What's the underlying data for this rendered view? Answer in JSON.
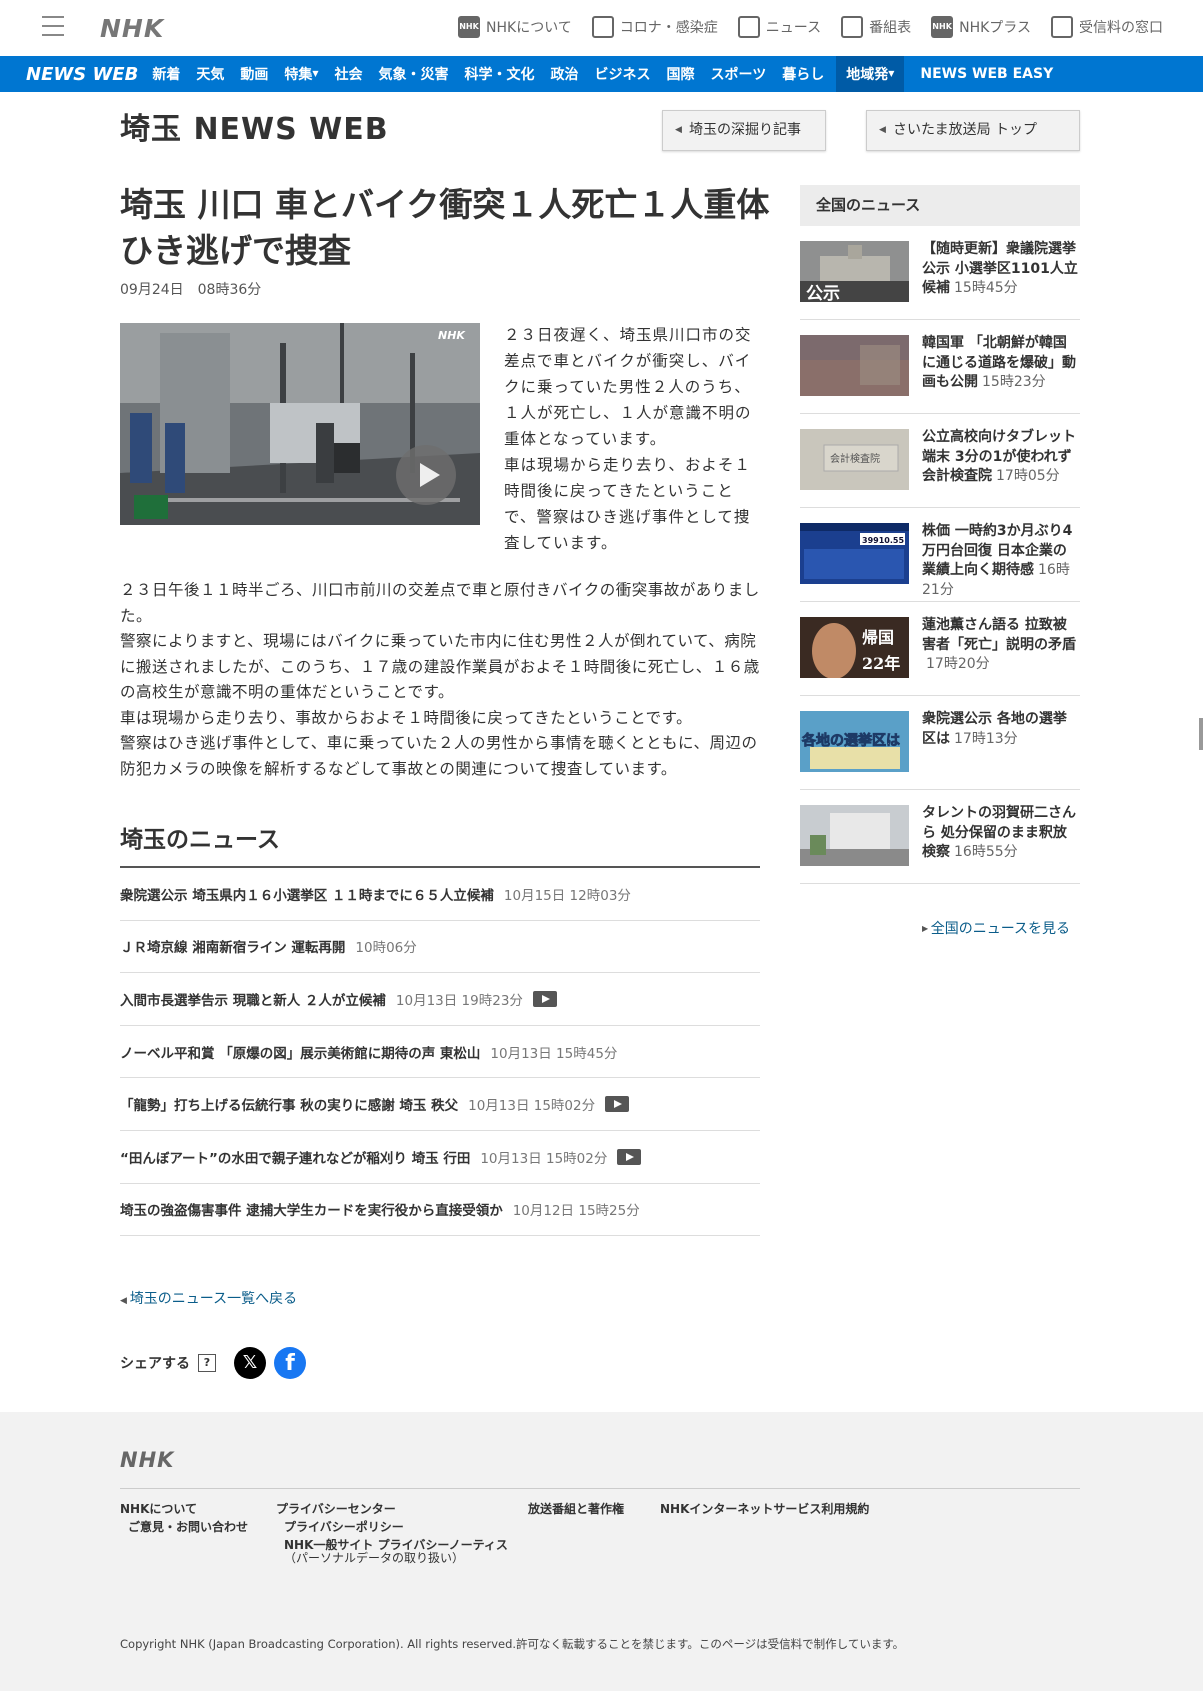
{
  "top": {
    "logo": "NHK",
    "links": [
      {
        "label": "NHKについて",
        "icon": "nhk-icon"
      },
      {
        "label": "コロナ・感染症",
        "icon": "document-icon"
      },
      {
        "label": "ニュース",
        "icon": "news-icon"
      },
      {
        "label": "番組表",
        "icon": "grid-icon"
      },
      {
        "label": "NHKプラス",
        "icon": "nhk-plus-icon"
      },
      {
        "label": "受信料の窓口",
        "icon": "tv-icon"
      }
    ]
  },
  "nav": {
    "brand": "NEWS WEB",
    "items": [
      "新着",
      "天気",
      "動画",
      "特集",
      "社会",
      "気象・災害",
      "科学・文化",
      "政治",
      "ビジネス",
      "国際",
      "スポーツ",
      "暮らし",
      "地域発",
      "NEWS WEB EASY"
    ]
  },
  "header": {
    "title": "埼玉 NEWS WEB",
    "btn_deep": "埼玉の深掘り記事",
    "btn_top": "さいたま放送局 トップ"
  },
  "article": {
    "title": "埼玉 川口 車とバイク衝突１人死亡１人重体 ひき逃げで捜査",
    "date": "09月24日　08時36分",
    "lead_1": "２３日夜遅く、埼玉県川口市の交差点で車とバイクが衝突し、バイクに乗っていた男性２人のうち、１人が死亡し、１人が意識不明の重体となっています。",
    "lead_2": "車は現場から走り去り、およそ１時間後に戻ってきたということで、警察はひき逃げ事件として捜査しています。",
    "body": [
      "２３日午後１１時半ごろ、川口市前川の交差点で車と原付きバイクの衝突事故がありました。",
      "警察によりますと、現場にはバイクに乗っていた市内に住む男性２人が倒れていて、病院に搬送されましたが、このうち、１７歳の建設作業員がおよそ１時間後に死亡し、１６歳の高校生が意識不明の重体だということです。",
      "車は現場から走り去り、事故からおよそ１時間後に戻ってきたということです。",
      "警察はひき逃げ事件として、車に乗っていた２人の男性から事情を聴くとともに、周辺の防犯カメラの映像を解析するなどして事故との関連について捜査しています。"
    ]
  },
  "regional": {
    "title": "埼玉のニュース",
    "items": [
      {
        "title": "衆院選公示 埼玉県内１６小選挙区 １１時までに６５人立候補",
        "time": "10月15日 12時03分"
      },
      {
        "title": "ＪＲ埼京線 湘南新宿ライン 運転再開",
        "time": "10時06分"
      },
      {
        "title": "入間市長選挙告示 現職と新人 ２人が立候補",
        "time": "10月13日 19時23分"
      },
      {
        "title": "ノーベル平和賞 「原爆の図」展示美術館に期待の声 東松山",
        "time": "10月13日 15時45分"
      },
      {
        "title": "「龍勢」打ち上げる伝統行事 秋の実りに感謝 埼玉 秩父",
        "time": "10月13日 15時02分"
      },
      {
        "title": "“田んぼアート”の水田で親子連れなどが稲刈り 埼玉 行田",
        "time": "10月13日 15時02分"
      },
      {
        "title": "埼玉の強盗傷害事件 逮捕大学生カードを実行役から直接受領か",
        "time": "10月12日 15時25分"
      }
    ],
    "back": "埼玉のニュース一覧へ戻る"
  },
  "share": {
    "label": "シェアする",
    "help": "?",
    "x": "𝕏",
    "fb": "f"
  },
  "sidebar": {
    "title": "全国のニュース",
    "items": [
      {
        "title": "【随時更新】衆議院選挙公示 小選挙区1101人立候補",
        "time": "15時45分"
      },
      {
        "title": "韓国軍 「北朝鮮が韓国に通じる道路を爆破」動画も公開",
        "time": "15時23分"
      },
      {
        "title": "公立高校向けタブレット端末 3分の1が使われず 会計検査院",
        "time": "17時05分"
      },
      {
        "title": "株価 一時約3か月ぶり4万円台回復 日本企業の業績上向く期待感",
        "time": "16時21分"
      },
      {
        "title": "蓮池薫さん語る 拉致被害者「死亡」説明の矛盾",
        "time": "17時20分"
      },
      {
        "title": "衆院選公示 各地の選挙区は",
        "time": "17時13分"
      },
      {
        "title": "タレントの羽賀研二さんら 処分保留のまま釈放 検察",
        "time": "16時55分"
      }
    ],
    "thumb_labels": {
      "kouji": "公示",
      "kikoku": "帰国",
      "years": "22年",
      "senkyoku": "各地の選挙区は",
      "kensa": "会計検査院",
      "stock": "39910.55"
    },
    "more": "全国のニュースを見る"
  },
  "footer": {
    "logo": "NHK",
    "about": "NHKについて",
    "contact": "ご意見・お問い合わせ",
    "privacy_center": "プライバシーセンター",
    "privacy_policy": "プライバシーポリシー",
    "privacy_notice": "NHK一般サイト プライバシーノーティス",
    "privacy_notice_sub": "（パーソナルデータの取り扱い）",
    "broadcast": "放送番組と著作権",
    "terms": "NHKインターネットサービス利用規約",
    "copyright": "Copyright NHK (Japan Broadcasting Corporation). All rights reserved.許可なく転載することを禁じます。このページは受信料で制作しています。"
  },
  "colors": {
    "nav_blue": "#0076d1",
    "link": "#0b5d8a"
  }
}
